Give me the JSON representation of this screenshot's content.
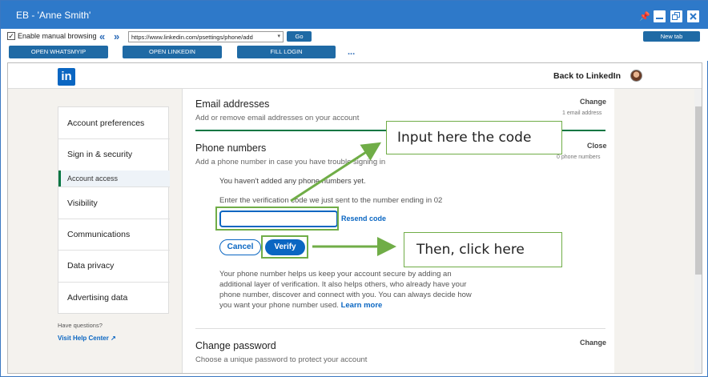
{
  "window": {
    "title": "EB - 'Anne Smith'"
  },
  "toolbar": {
    "enable_label": "Enable manual browsing",
    "url": "https://www.linkedin.com/psettings/phone/add",
    "go_label": "Go",
    "new_tab_label": "New tab",
    "buttons": [
      "OPEN WHATSMYIP",
      "OPEN LINKEDIN",
      "FILL LOGIN"
    ],
    "more": "..."
  },
  "header": {
    "logo": "in",
    "back_link": "Back to LinkedIn"
  },
  "sidebar": {
    "items": [
      "Account preferences",
      "Sign in & security",
      "Account access",
      "Visibility",
      "Communications",
      "Data privacy",
      "Advertising data"
    ],
    "help_question": "Have questions?",
    "help_link": "Visit Help Center"
  },
  "email": {
    "title": "Email addresses",
    "subtitle": "Add or remove email addresses on your account",
    "action": "Change",
    "count": "1 email address"
  },
  "phone": {
    "title": "Phone numbers",
    "subtitle": "Add a phone number in case you have trouble signing in",
    "action": "Close",
    "count": "0 phone numbers",
    "none_text": "You haven't added any phone numbers yet.",
    "prompt": "Enter the verification code we just sent to the number ending in 02",
    "code_value": "",
    "resend": "Resend code",
    "cancel": "Cancel",
    "verify": "Verify",
    "info": [
      "Your phone number helps us keep your account secure by adding an",
      "additional layer of verification. It also helps others, who already have your",
      "phone number, discover and connect with you. You can always decide how"
    ],
    "info_last": "you want your phone number used.",
    "learn_more": "Learn more"
  },
  "password": {
    "title": "Change password",
    "subtitle": "Choose a unique password to protect your account",
    "action": "Change"
  },
  "annotations": {
    "input_note": "Input here the code",
    "click_note": "Then, click here"
  },
  "colors": {
    "titlebar": "#2e79c9",
    "linkedin_blue": "#0a66c2",
    "annotation_green": "#70ad47"
  }
}
